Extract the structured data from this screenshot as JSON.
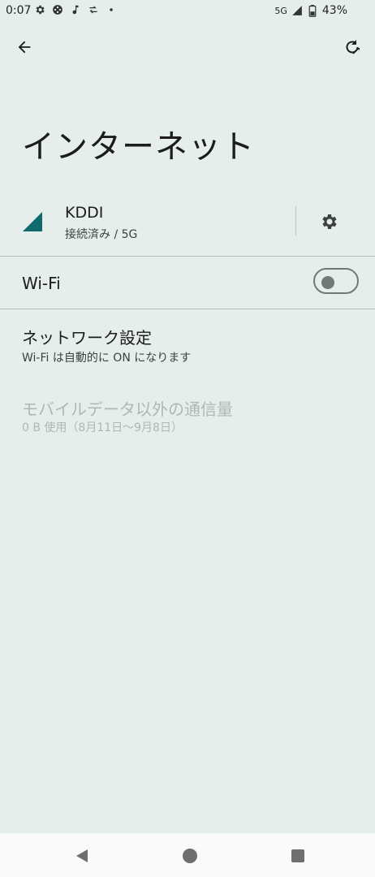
{
  "status_bar": {
    "time": "0:07",
    "network": "5G",
    "battery": "43%",
    "left_icons": [
      "gear-icon",
      "game-controller-icon",
      "music-note-icon",
      "sync-icon",
      "dot-icon"
    ]
  },
  "header": {
    "title": "インターネット"
  },
  "carrier": {
    "name": "KDDI",
    "status": "接続済み / 5G"
  },
  "wifi": {
    "label": "Wi-Fi",
    "enabled": false
  },
  "network_settings": {
    "title": "ネットワーク設定",
    "subtitle": "Wi-Fi は自動的に ON になります"
  },
  "non_mobile_data": {
    "title": "モバイルデータ以外の通信量",
    "subtitle": "0 B 使用（8月11日～9月8日）"
  },
  "colors": {
    "background": "#e6eeec",
    "accent": "#0f6b6b",
    "disabled_text": "#b0b6b5"
  }
}
